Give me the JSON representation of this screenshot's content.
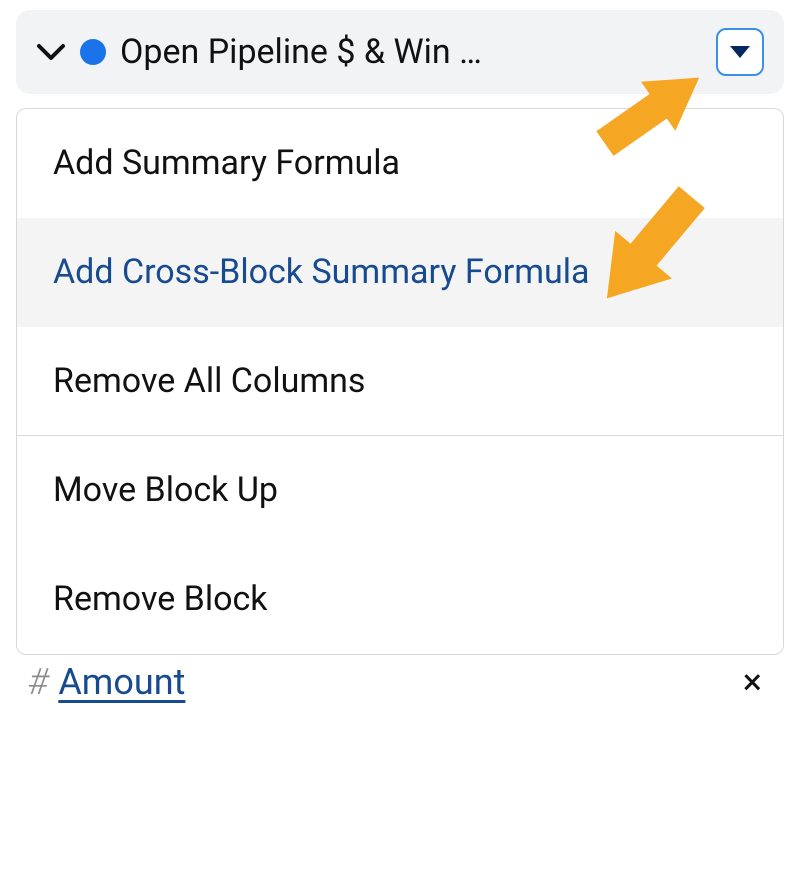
{
  "header": {
    "title": "Open Pipeline $ & Win …"
  },
  "menu": {
    "items": [
      {
        "label": "Add Summary Formula",
        "highlighted": false
      },
      {
        "label": "Add Cross-Block Summary Formula",
        "highlighted": true
      },
      {
        "label": "Remove All Columns",
        "highlighted": false
      }
    ],
    "items2": [
      {
        "label": "Move Block Up",
        "highlighted": false
      },
      {
        "label": "Remove Block",
        "highlighted": false
      }
    ]
  },
  "bottom": {
    "label": "Amount"
  }
}
